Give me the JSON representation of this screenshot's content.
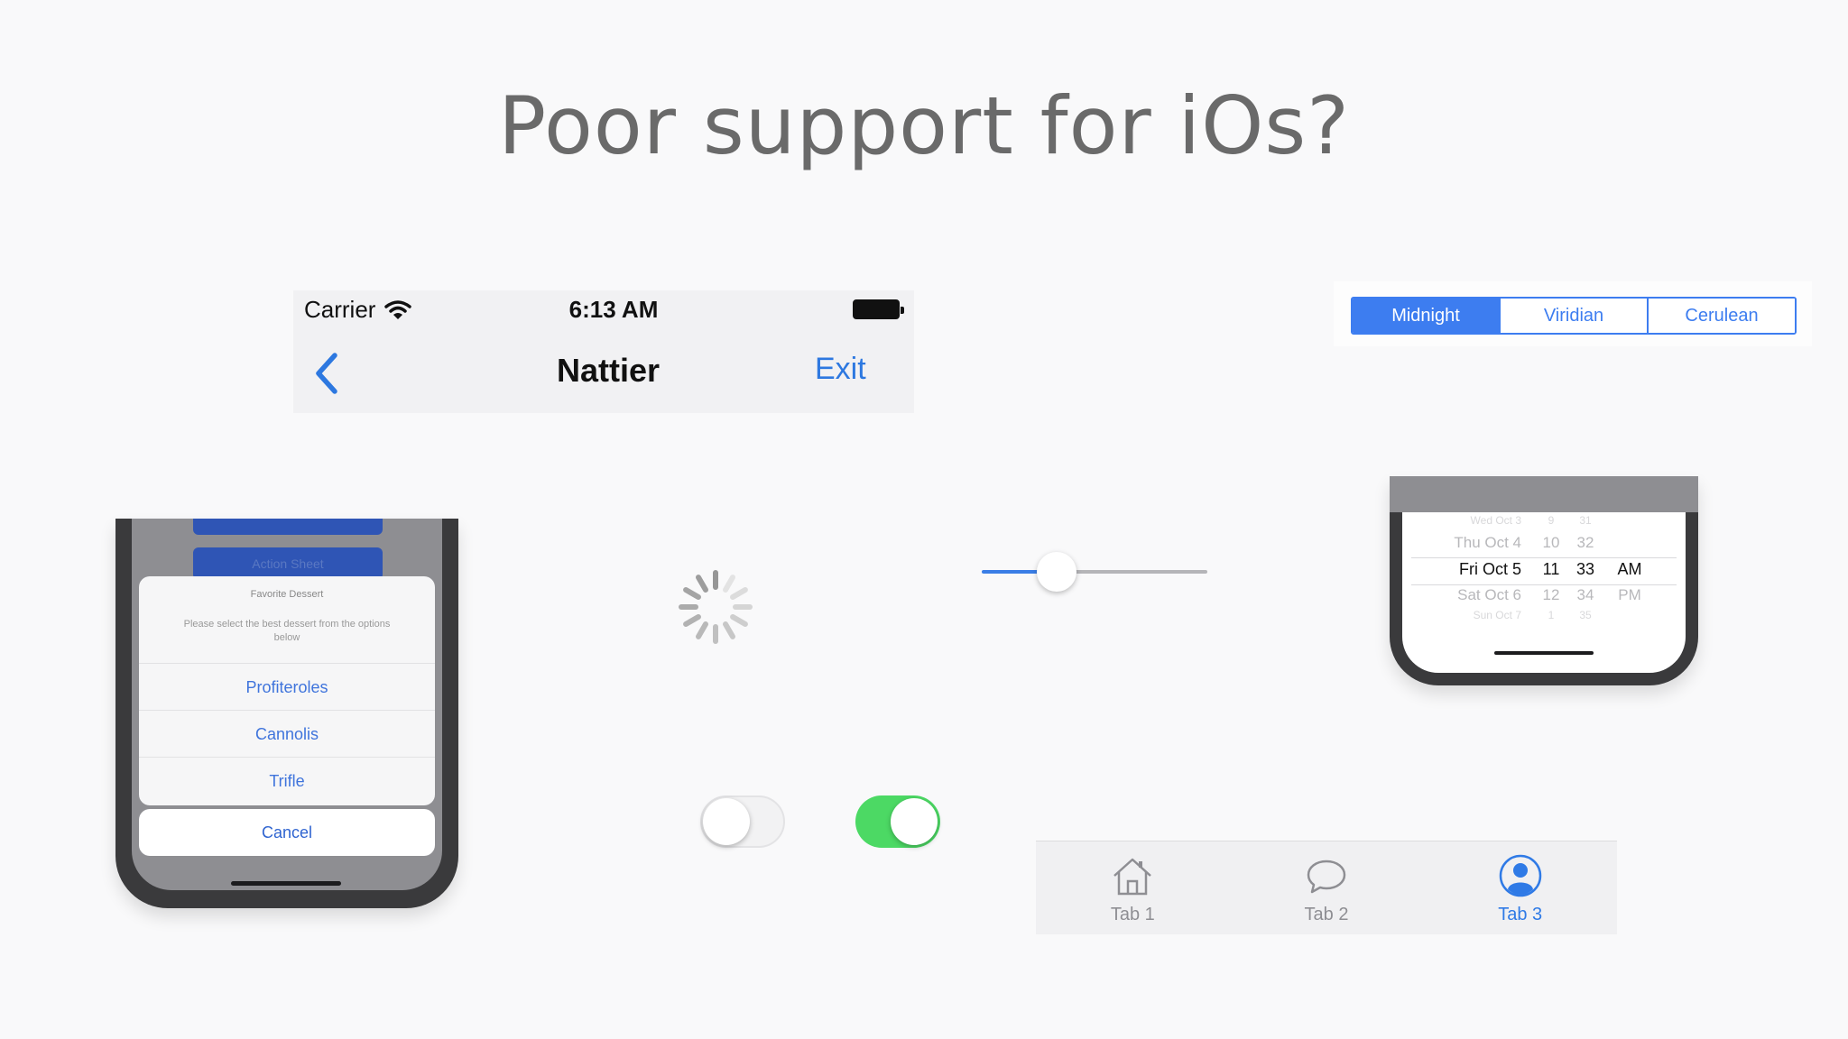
{
  "slide": {
    "title": "Poor support for iOs?"
  },
  "nav_bar": {
    "carrier": "Carrier",
    "time": "6:13 AM",
    "title": "Nattier",
    "right_button": "Exit",
    "back_icon": "chevron-left-icon",
    "wifi_icon": "wifi-icon",
    "battery_icon": "battery-icon"
  },
  "segmented_control": {
    "segments": [
      "Midnight",
      "Viridian",
      "Cerulean"
    ],
    "selected": "Midnight",
    "accent_color": "#3d7df0"
  },
  "action_sheet": {
    "background_button": "Action Sheet",
    "title": "Favorite Dessert",
    "message": "Please select the best dessert from the options below",
    "options": [
      "Profiteroles",
      "Cannolis",
      "Trifle"
    ],
    "cancel": "Cancel"
  },
  "activity_indicator": {
    "icon": "spinner-icon"
  },
  "slider": {
    "value": 0.33,
    "min_track_color": "#3a7ee6"
  },
  "date_picker": {
    "rows": [
      {
        "date": "Wed Oct 3",
        "hour": "9",
        "minute": "31",
        "ampm": ""
      },
      {
        "date": "Thu Oct 4",
        "hour": "10",
        "minute": "32",
        "ampm": ""
      },
      {
        "date": "Fri Oct 5",
        "hour": "11",
        "minute": "33",
        "ampm": "AM"
      },
      {
        "date": "Sat Oct 6",
        "hour": "12",
        "minute": "34",
        "ampm": "PM"
      },
      {
        "date": "Sun Oct 7",
        "hour": "1",
        "minute": "35",
        "ampm": ""
      }
    ],
    "selected_index": 2
  },
  "switches": [
    {
      "state": "off"
    },
    {
      "state": "on",
      "color": "#4cd964"
    }
  ],
  "tab_bar": {
    "tabs": [
      {
        "label": "Tab 1",
        "icon": "house-icon"
      },
      {
        "label": "Tab 2",
        "icon": "chat-bubble-icon"
      },
      {
        "label": "Tab 3",
        "icon": "person-icon"
      }
    ],
    "selected": "Tab 3",
    "accent_color": "#2f7ae6"
  }
}
